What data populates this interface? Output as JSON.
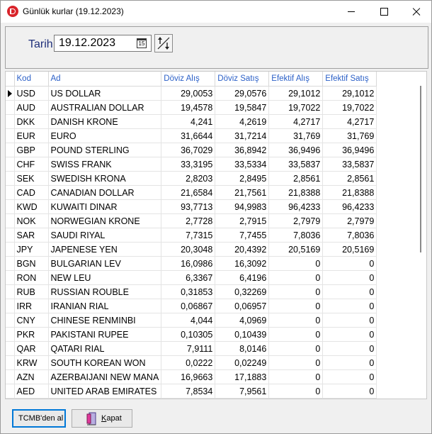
{
  "window": {
    "title": "Günlük kurlar (19.12.2023)",
    "accent": "#d9242b"
  },
  "toolbar": {
    "date_label": "Tarih",
    "date_value": "19.12.2023",
    "calendar_day": "15"
  },
  "grid": {
    "columns": [
      "Kod",
      "Ad",
      "Döviz Alış",
      "Döviz Satış",
      "Efektif Alış",
      "Efektif Satış"
    ],
    "rows": [
      {
        "kod": "USD",
        "ad": "US DOLLAR",
        "doviz_alis": "29,0053",
        "doviz_satis": "29,0576",
        "efektif_alis": "29,1012",
        "efektif_satis": "29,1012"
      },
      {
        "kod": "AUD",
        "ad": "AUSTRALIAN DOLLAR",
        "doviz_alis": "19,4578",
        "doviz_satis": "19,5847",
        "efektif_alis": "19,7022",
        "efektif_satis": "19,7022"
      },
      {
        "kod": "DKK",
        "ad": "DANISH KRONE",
        "doviz_alis": "4,241",
        "doviz_satis": "4,2619",
        "efektif_alis": "4,2717",
        "efektif_satis": "4,2717"
      },
      {
        "kod": "EUR",
        "ad": "EURO",
        "doviz_alis": "31,6644",
        "doviz_satis": "31,7214",
        "efektif_alis": "31,769",
        "efektif_satis": "31,769"
      },
      {
        "kod": "GBP",
        "ad": "POUND STERLING",
        "doviz_alis": "36,7029",
        "doviz_satis": "36,8942",
        "efektif_alis": "36,9496",
        "efektif_satis": "36,9496"
      },
      {
        "kod": "CHF",
        "ad": "SWISS FRANK",
        "doviz_alis": "33,3195",
        "doviz_satis": "33,5334",
        "efektif_alis": "33,5837",
        "efektif_satis": "33,5837"
      },
      {
        "kod": "SEK",
        "ad": "SWEDISH KRONA",
        "doviz_alis": "2,8203",
        "doviz_satis": "2,8495",
        "efektif_alis": "2,8561",
        "efektif_satis": "2,8561"
      },
      {
        "kod": "CAD",
        "ad": "CANADIAN DOLLAR",
        "doviz_alis": "21,6584",
        "doviz_satis": "21,7561",
        "efektif_alis": "21,8388",
        "efektif_satis": "21,8388"
      },
      {
        "kod": "KWD",
        "ad": "KUWAITI DINAR",
        "doviz_alis": "93,7713",
        "doviz_satis": "94,9983",
        "efektif_alis": "96,4233",
        "efektif_satis": "96,4233"
      },
      {
        "kod": "NOK",
        "ad": "NORWEGIAN KRONE",
        "doviz_alis": "2,7728",
        "doviz_satis": "2,7915",
        "efektif_alis": "2,7979",
        "efektif_satis": "2,7979"
      },
      {
        "kod": "SAR",
        "ad": "SAUDI RIYAL",
        "doviz_alis": "7,7315",
        "doviz_satis": "7,7455",
        "efektif_alis": "7,8036",
        "efektif_satis": "7,8036"
      },
      {
        "kod": "JPY",
        "ad": "JAPENESE YEN",
        "doviz_alis": "20,3048",
        "doviz_satis": "20,4392",
        "efektif_alis": "20,5169",
        "efektif_satis": "20,5169"
      },
      {
        "kod": "BGN",
        "ad": "BULGARIAN LEV",
        "doviz_alis": "16,0986",
        "doviz_satis": "16,3092",
        "efektif_alis": "0",
        "efektif_satis": "0"
      },
      {
        "kod": "RON",
        "ad": "NEW LEU",
        "doviz_alis": "6,3367",
        "doviz_satis": "6,4196",
        "efektif_alis": "0",
        "efektif_satis": "0"
      },
      {
        "kod": "RUB",
        "ad": "RUSSIAN ROUBLE",
        "doviz_alis": "0,31853",
        "doviz_satis": "0,32269",
        "efektif_alis": "0",
        "efektif_satis": "0"
      },
      {
        "kod": "IRR",
        "ad": "IRANIAN RIAL",
        "doviz_alis": "0,06867",
        "doviz_satis": "0,06957",
        "efektif_alis": "0",
        "efektif_satis": "0"
      },
      {
        "kod": "CNY",
        "ad": "CHINESE RENMINBI",
        "doviz_alis": "4,044",
        "doviz_satis": "4,0969",
        "efektif_alis": "0",
        "efektif_satis": "0"
      },
      {
        "kod": "PKR",
        "ad": "PAKISTANI RUPEE",
        "doviz_alis": "0,10305",
        "doviz_satis": "0,10439",
        "efektif_alis": "0",
        "efektif_satis": "0"
      },
      {
        "kod": "QAR",
        "ad": "QATARI RIAL",
        "doviz_alis": "7,9111",
        "doviz_satis": "8,0146",
        "efektif_alis": "0",
        "efektif_satis": "0"
      },
      {
        "kod": "KRW",
        "ad": "SOUTH KOREAN WON",
        "doviz_alis": "0,0222",
        "doviz_satis": "0,02249",
        "efektif_alis": "0",
        "efektif_satis": "0"
      },
      {
        "kod": "AZN",
        "ad": "AZERBAIJANI NEW MANA",
        "doviz_alis": "16,9663",
        "doviz_satis": "17,1883",
        "efektif_alis": "0",
        "efektif_satis": "0"
      },
      {
        "kod": "AED",
        "ad": "UNITED ARAB EMIRATES",
        "doviz_alis": "7,8534",
        "doviz_satis": "7,9561",
        "efektif_alis": "0",
        "efektif_satis": "0"
      }
    ],
    "selected_row": 0
  },
  "buttons": {
    "fetch_label": "TCMB'den al",
    "close_label": "Kapat",
    "close_accel": "K"
  },
  "icons": {
    "app": "app-logo-icon",
    "calendar": "calendar-icon",
    "sort": "sort-arrows-icon",
    "exit": "exit-door-icon"
  }
}
